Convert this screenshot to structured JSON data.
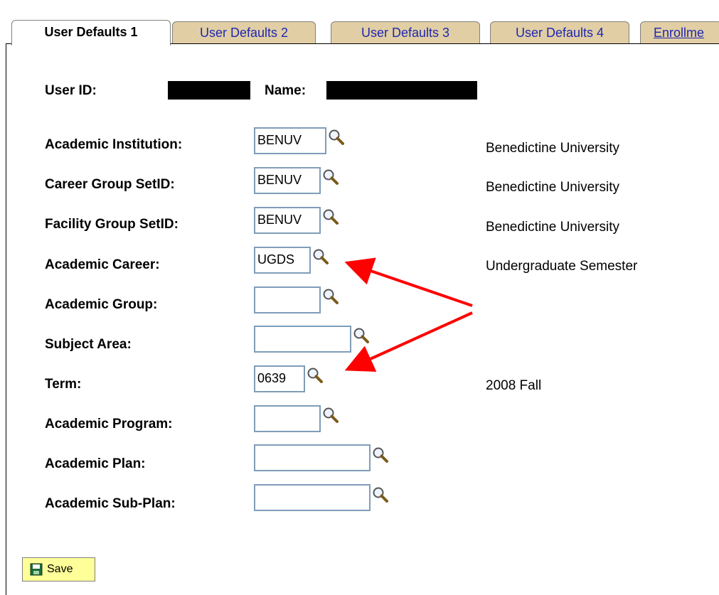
{
  "tabs": [
    {
      "label": "User Defaults 1",
      "active": true
    },
    {
      "label": "User Defaults 2",
      "active": false
    },
    {
      "label": "User Defaults 3",
      "active": false
    },
    {
      "label": "User Defaults 4",
      "active": false
    },
    {
      "label": "Enrollme",
      "active": false
    }
  ],
  "header": {
    "user_id_label": "User ID:",
    "name_label": "Name:"
  },
  "fields": [
    {
      "label": "Academic Institution:",
      "value": "BENUV",
      "description": "Benedictine University"
    },
    {
      "label": "Career Group SetID:",
      "value": "BENUV",
      "description": "Benedictine University"
    },
    {
      "label": "Facility Group SetID:",
      "value": "BENUV",
      "description": "Benedictine University"
    },
    {
      "label": "Academic Career:",
      "value": "UGDS",
      "description": "Undergraduate Semester"
    },
    {
      "label": "Academic Group:",
      "value": "",
      "description": ""
    },
    {
      "label": "Subject Area:",
      "value": "",
      "description": ""
    },
    {
      "label": "Term:",
      "value": "0639",
      "description": "2008 Fall"
    },
    {
      "label": "Academic Program:",
      "value": "",
      "description": ""
    },
    {
      "label": "Academic Plan:",
      "value": "",
      "description": ""
    },
    {
      "label": "Academic Sub-Plan:",
      "value": "",
      "description": ""
    }
  ],
  "actions": {
    "save_label": "Save"
  },
  "icons": {
    "lookup": "magnifier-icon",
    "save": "floppy-disk-icon"
  },
  "colors": {
    "active_tab": "#ffffff",
    "inactive_tab": "#e1cea4",
    "tab_link": "#1f28b0",
    "field_border": "#7f9db9",
    "save_button": "#ffff99",
    "annotation_arrow": "#ff0000"
  }
}
